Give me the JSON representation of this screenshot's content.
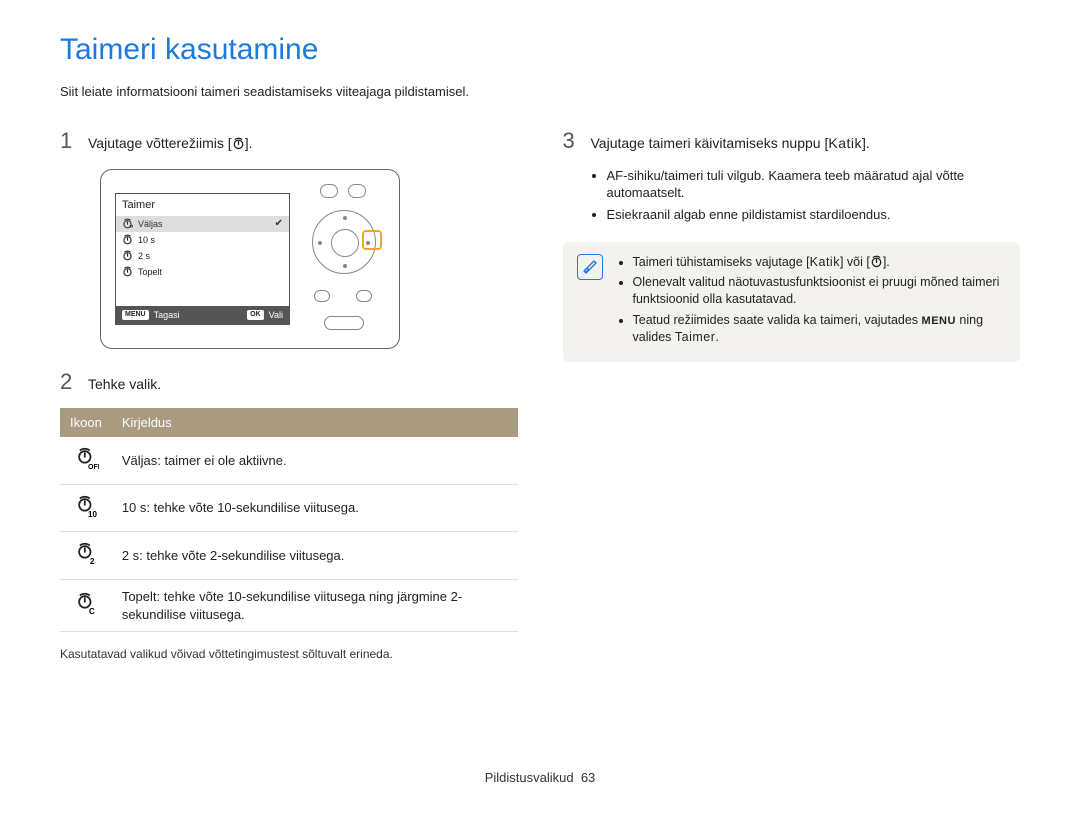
{
  "title": "Taimeri kasutamine",
  "intro": "Siit leiate informatsiooni taimeri seadistamiseks viiteajaga pildistamisel.",
  "step1": {
    "num": "1",
    "text_prefix": "Vajutage võtterežiimis [",
    "text_suffix": "]."
  },
  "camera_menu": {
    "title": "Taimer",
    "items": [
      {
        "label": "Väljas",
        "selected": true
      },
      {
        "label": "10 s",
        "selected": false
      },
      {
        "label": "2 s",
        "selected": false
      },
      {
        "label": "Topelt",
        "selected": false
      }
    ],
    "footer": {
      "left_btn": "MENU",
      "left_label": "Tagasi",
      "right_btn": "OK",
      "right_label": "Vali"
    }
  },
  "step2": {
    "num": "2",
    "text": "Tehke valik."
  },
  "table": {
    "head": {
      "c1": "Ikoon",
      "c2": "Kirjeldus"
    },
    "rows": [
      {
        "icon": "off",
        "text": "Väljas: taimer ei ole aktiivne."
      },
      {
        "icon": "t10",
        "text": "10 s: tehke võte 10-sekundilise viitusega."
      },
      {
        "icon": "t2",
        "text": "2 s: tehke võte 2-sekundilise viitusega."
      },
      {
        "icon": "dbl",
        "text": "Topelt: tehke võte 10-sekundilise viitusega ning järgmine 2-sekundilise viitusega."
      }
    ]
  },
  "table_note": "Kasutatavad valikud võivad võttetingimustest sõltuvalt erineda.",
  "step3": {
    "num": "3",
    "text_prefix": "Vajutage taimeri käivitamiseks nuppu [",
    "btn": "Katik",
    "text_suffix": "]."
  },
  "step3_bullets": [
    "AF-sihiku/taimeri tuli vilgub. Kaamera teeb määratud ajal võtte automaatselt.",
    "Esiekraanil algab enne pildistamist stardiloendus."
  ],
  "info": {
    "items": [
      {
        "prefix": "Taimeri tühistamiseks vajutage [",
        "btn1": "Katik",
        "mid": "] või [",
        "btn_icon": true,
        "suffix": "]."
      },
      {
        "full": "Olenevalt valitud näotuvastusfunktsioonist ei pruugi mõned taimeri funktsioonid olla kasutatavad."
      },
      {
        "prefix": "Teatud režiimides saate valida ka taimeri, vajutades ",
        "menu": "MENU",
        "mid2": " ning valides ",
        "opt": "Taimer",
        "suffix2": "."
      }
    ]
  },
  "footer": {
    "section": "Pildistusvalikud",
    "page": "63"
  }
}
